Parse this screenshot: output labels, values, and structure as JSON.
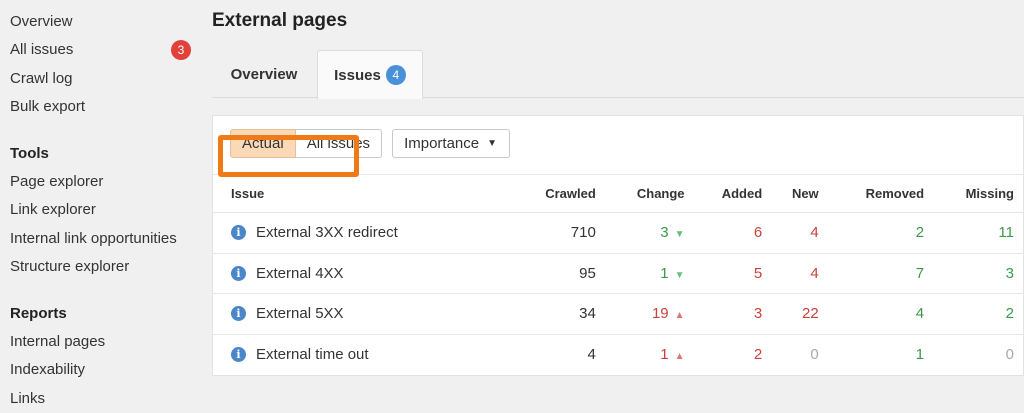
{
  "sidebar": {
    "items": [
      {
        "label": "Overview"
      },
      {
        "label": "All issues",
        "badge": "3"
      },
      {
        "label": "Crawl log"
      },
      {
        "label": "Bulk export"
      }
    ],
    "tools_heading": "Tools",
    "tools": [
      {
        "label": "Page explorer"
      },
      {
        "label": "Link explorer"
      },
      {
        "label": "Internal link opportunities"
      },
      {
        "label": "Structure explorer"
      }
    ],
    "reports_heading": "Reports",
    "reports": [
      {
        "label": "Internal pages"
      },
      {
        "label": "Indexability"
      },
      {
        "label": "Links"
      }
    ]
  },
  "header": {
    "title": "External pages"
  },
  "tabs": [
    {
      "label": "Overview"
    },
    {
      "label": "Issues",
      "badge": "4",
      "active": true
    }
  ],
  "filters": {
    "actual": "Actual",
    "all_issues": "All issues",
    "importance": "Importance"
  },
  "table": {
    "columns": [
      "Issue",
      "Crawled",
      "Change",
      "Added",
      "New",
      "Removed",
      "Missing"
    ],
    "rows": [
      {
        "issue": "External 3XX redirect",
        "crawled": "710",
        "change": "3",
        "change_dir": "down",
        "added": "6",
        "new": "4",
        "removed": "2",
        "missing": "11"
      },
      {
        "issue": "External 4XX",
        "crawled": "95",
        "change": "1",
        "change_dir": "down",
        "added": "5",
        "new": "4",
        "removed": "7",
        "missing": "3"
      },
      {
        "issue": "External 5XX",
        "crawled": "34",
        "change": "19",
        "change_dir": "up",
        "added": "3",
        "new": "22",
        "removed": "4",
        "missing": "2"
      },
      {
        "issue": "External time out",
        "crawled": "4",
        "change": "1",
        "change_dir": "up",
        "added": "2",
        "new": "0",
        "removed": "1",
        "missing": "0"
      }
    ]
  },
  "colors": {
    "accent_orange": "#f07b16",
    "badge_red": "#e0413b",
    "badge_blue": "#4a90d9",
    "negative": "#c9413b",
    "positive": "#3a9a4a",
    "active_filter": "#fbd9b6"
  },
  "icons": {
    "info": "info-icon",
    "arrow_down": "triangle-down-icon",
    "arrow_up": "triangle-up-icon",
    "caret": "caret-down-icon"
  }
}
